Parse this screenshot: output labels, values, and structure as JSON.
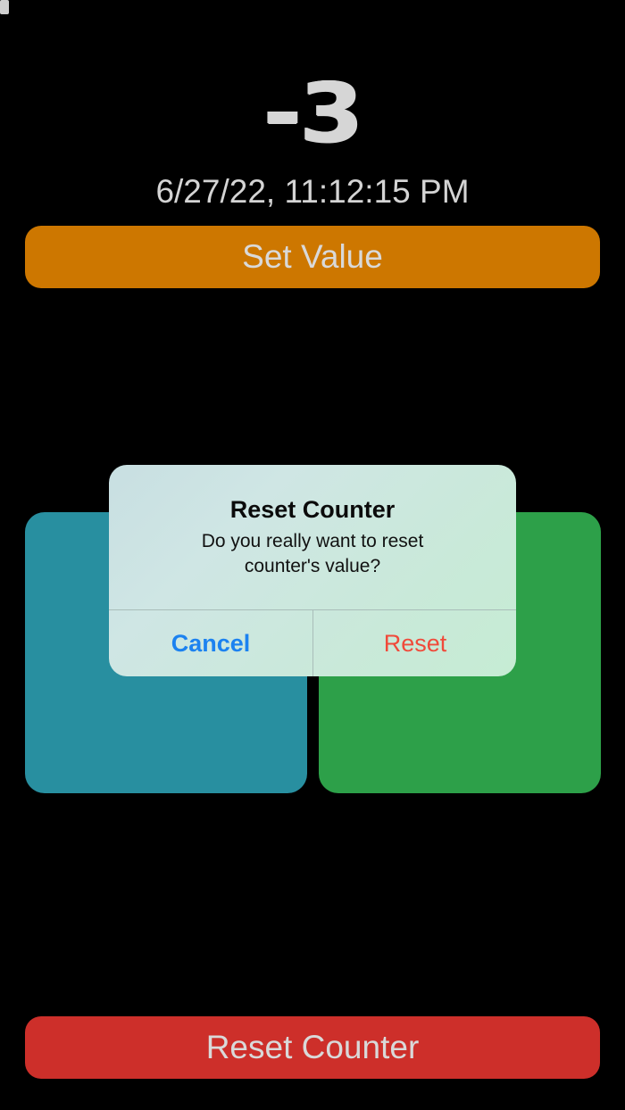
{
  "counter": {
    "value": "-3",
    "timestamp": "6/27/22, 11:12:15 PM"
  },
  "buttons": {
    "set_value_label": "Set Value",
    "reset_counter_label": "Reset Counter"
  },
  "tiles": {
    "decrement_color": "#288fa0",
    "increment_color": "#2da049"
  },
  "alert": {
    "title": "Reset Counter",
    "message_line1": "Do you really want to reset",
    "message_line2": "counter's value?",
    "cancel_label": "Cancel",
    "reset_label": "Reset"
  },
  "colors": {
    "background": "#000000",
    "set_value": "#cd7700",
    "reset_counter": "#cd2f2a",
    "alert_cancel": "#1c82f0",
    "alert_reset": "#f04a3a"
  }
}
